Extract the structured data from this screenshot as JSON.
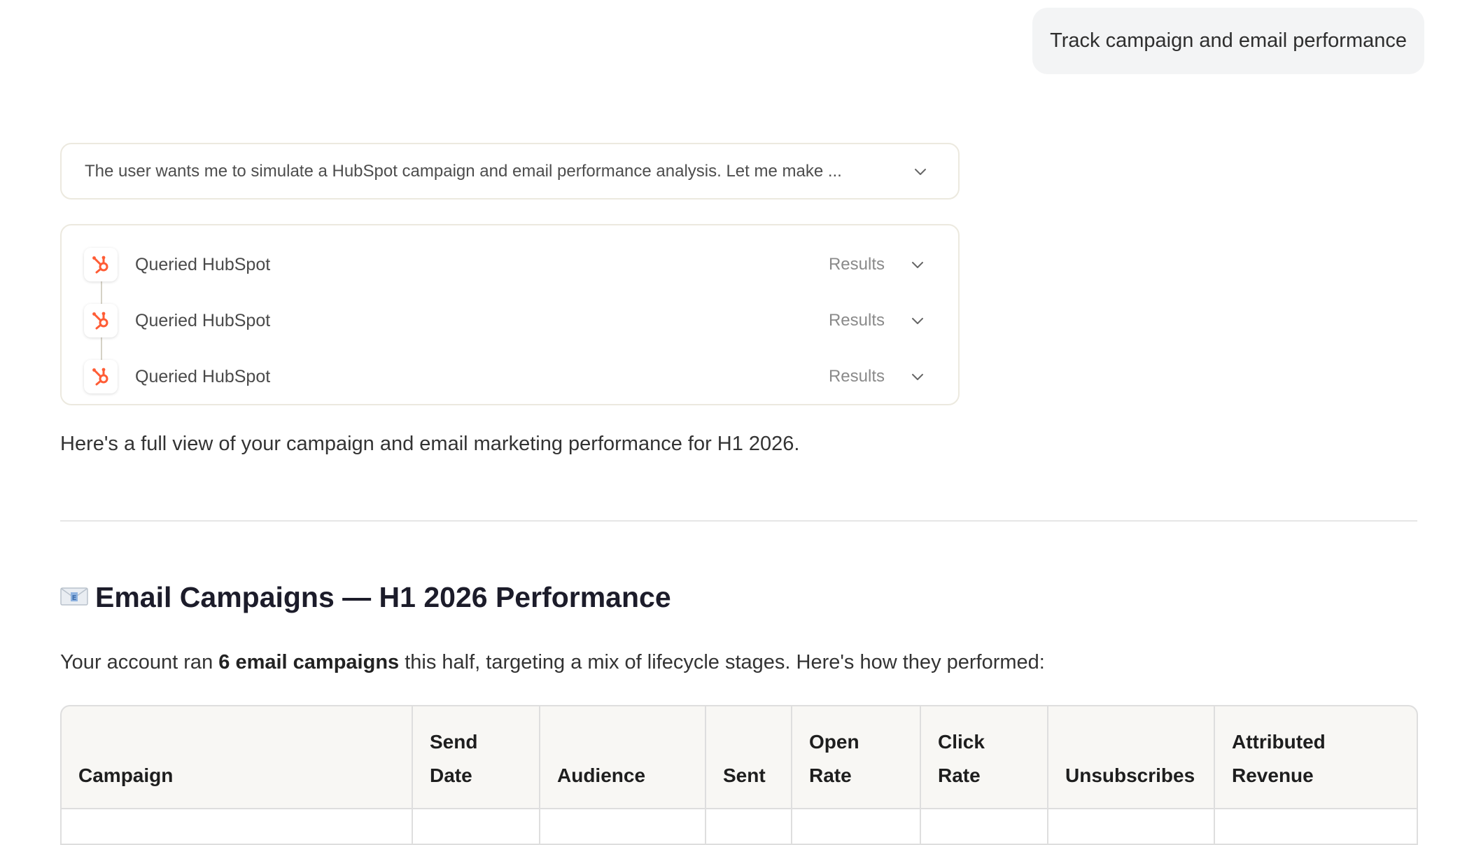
{
  "user_message": "Track campaign and email performance",
  "thinking": {
    "summary": "The user wants me to simulate a HubSpot campaign and email performance analysis. Let me make ..."
  },
  "tool_calls": [
    {
      "label": "Queried HubSpot",
      "results_label": "Results",
      "icon": "hubspot-icon"
    },
    {
      "label": "Queried HubSpot",
      "results_label": "Results",
      "icon": "hubspot-icon"
    },
    {
      "label": "Queried HubSpot",
      "results_label": "Results",
      "icon": "hubspot-icon"
    }
  ],
  "intro_text": "Here's a full view of your campaign and email marketing performance for H1 2026.",
  "section": {
    "icon": "envelope-icon",
    "heading": "Email Campaigns — H1 2026 Performance",
    "summary_prefix": "Your account ran ",
    "summary_bold": "6 email campaigns",
    "summary_suffix": " this half, targeting a mix of lifecycle stages. Here's how they performed:"
  },
  "table": {
    "columns": [
      "Campaign",
      "Send Date",
      "Audience",
      "Sent",
      "Open Rate",
      "Click Rate",
      "Unsubscribes",
      "Attributed Revenue"
    ]
  },
  "colors": {
    "hubspot_orange": "#ff5c35",
    "border": "#ece9df",
    "header_bg": "#f8f7f4"
  }
}
